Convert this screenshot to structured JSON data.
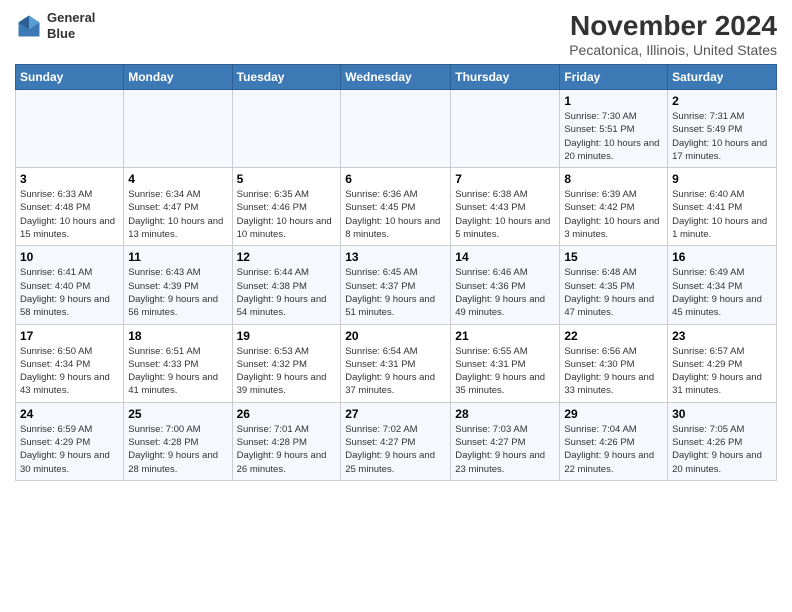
{
  "logo": {
    "line1": "General",
    "line2": "Blue"
  },
  "title": "November 2024",
  "subtitle": "Pecatonica, Illinois, United States",
  "days_header": [
    "Sunday",
    "Monday",
    "Tuesday",
    "Wednesday",
    "Thursday",
    "Friday",
    "Saturday"
  ],
  "weeks": [
    [
      {
        "day": "",
        "info": ""
      },
      {
        "day": "",
        "info": ""
      },
      {
        "day": "",
        "info": ""
      },
      {
        "day": "",
        "info": ""
      },
      {
        "day": "",
        "info": ""
      },
      {
        "day": "1",
        "info": "Sunrise: 7:30 AM\nSunset: 5:51 PM\nDaylight: 10 hours and 20 minutes."
      },
      {
        "day": "2",
        "info": "Sunrise: 7:31 AM\nSunset: 5:49 PM\nDaylight: 10 hours and 17 minutes."
      }
    ],
    [
      {
        "day": "3",
        "info": "Sunrise: 6:33 AM\nSunset: 4:48 PM\nDaylight: 10 hours and 15 minutes."
      },
      {
        "day": "4",
        "info": "Sunrise: 6:34 AM\nSunset: 4:47 PM\nDaylight: 10 hours and 13 minutes."
      },
      {
        "day": "5",
        "info": "Sunrise: 6:35 AM\nSunset: 4:46 PM\nDaylight: 10 hours and 10 minutes."
      },
      {
        "day": "6",
        "info": "Sunrise: 6:36 AM\nSunset: 4:45 PM\nDaylight: 10 hours and 8 minutes."
      },
      {
        "day": "7",
        "info": "Sunrise: 6:38 AM\nSunset: 4:43 PM\nDaylight: 10 hours and 5 minutes."
      },
      {
        "day": "8",
        "info": "Sunrise: 6:39 AM\nSunset: 4:42 PM\nDaylight: 10 hours and 3 minutes."
      },
      {
        "day": "9",
        "info": "Sunrise: 6:40 AM\nSunset: 4:41 PM\nDaylight: 10 hours and 1 minute."
      }
    ],
    [
      {
        "day": "10",
        "info": "Sunrise: 6:41 AM\nSunset: 4:40 PM\nDaylight: 9 hours and 58 minutes."
      },
      {
        "day": "11",
        "info": "Sunrise: 6:43 AM\nSunset: 4:39 PM\nDaylight: 9 hours and 56 minutes."
      },
      {
        "day": "12",
        "info": "Sunrise: 6:44 AM\nSunset: 4:38 PM\nDaylight: 9 hours and 54 minutes."
      },
      {
        "day": "13",
        "info": "Sunrise: 6:45 AM\nSunset: 4:37 PM\nDaylight: 9 hours and 51 minutes."
      },
      {
        "day": "14",
        "info": "Sunrise: 6:46 AM\nSunset: 4:36 PM\nDaylight: 9 hours and 49 minutes."
      },
      {
        "day": "15",
        "info": "Sunrise: 6:48 AM\nSunset: 4:35 PM\nDaylight: 9 hours and 47 minutes."
      },
      {
        "day": "16",
        "info": "Sunrise: 6:49 AM\nSunset: 4:34 PM\nDaylight: 9 hours and 45 minutes."
      }
    ],
    [
      {
        "day": "17",
        "info": "Sunrise: 6:50 AM\nSunset: 4:34 PM\nDaylight: 9 hours and 43 minutes."
      },
      {
        "day": "18",
        "info": "Sunrise: 6:51 AM\nSunset: 4:33 PM\nDaylight: 9 hours and 41 minutes."
      },
      {
        "day": "19",
        "info": "Sunrise: 6:53 AM\nSunset: 4:32 PM\nDaylight: 9 hours and 39 minutes."
      },
      {
        "day": "20",
        "info": "Sunrise: 6:54 AM\nSunset: 4:31 PM\nDaylight: 9 hours and 37 minutes."
      },
      {
        "day": "21",
        "info": "Sunrise: 6:55 AM\nSunset: 4:31 PM\nDaylight: 9 hours and 35 minutes."
      },
      {
        "day": "22",
        "info": "Sunrise: 6:56 AM\nSunset: 4:30 PM\nDaylight: 9 hours and 33 minutes."
      },
      {
        "day": "23",
        "info": "Sunrise: 6:57 AM\nSunset: 4:29 PM\nDaylight: 9 hours and 31 minutes."
      }
    ],
    [
      {
        "day": "24",
        "info": "Sunrise: 6:59 AM\nSunset: 4:29 PM\nDaylight: 9 hours and 30 minutes."
      },
      {
        "day": "25",
        "info": "Sunrise: 7:00 AM\nSunset: 4:28 PM\nDaylight: 9 hours and 28 minutes."
      },
      {
        "day": "26",
        "info": "Sunrise: 7:01 AM\nSunset: 4:28 PM\nDaylight: 9 hours and 26 minutes."
      },
      {
        "day": "27",
        "info": "Sunrise: 7:02 AM\nSunset: 4:27 PM\nDaylight: 9 hours and 25 minutes."
      },
      {
        "day": "28",
        "info": "Sunrise: 7:03 AM\nSunset: 4:27 PM\nDaylight: 9 hours and 23 minutes."
      },
      {
        "day": "29",
        "info": "Sunrise: 7:04 AM\nSunset: 4:26 PM\nDaylight: 9 hours and 22 minutes."
      },
      {
        "day": "30",
        "info": "Sunrise: 7:05 AM\nSunset: 4:26 PM\nDaylight: 9 hours and 20 minutes."
      }
    ]
  ]
}
